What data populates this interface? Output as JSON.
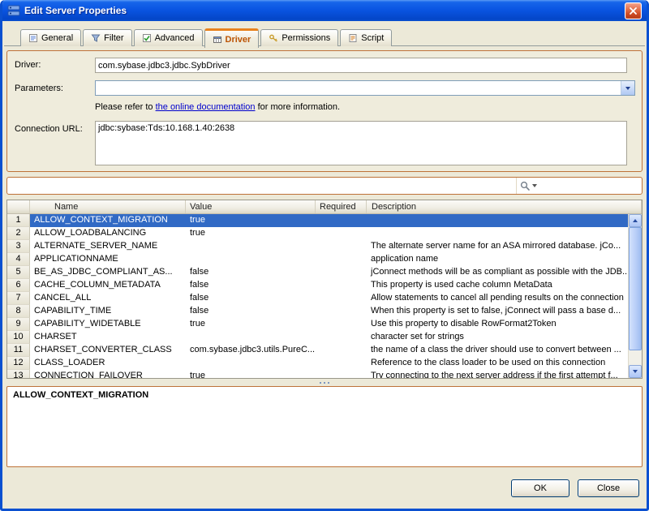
{
  "window": {
    "title": "Edit Server Properties"
  },
  "tabs": [
    {
      "label": "General"
    },
    {
      "label": "Filter"
    },
    {
      "label": "Advanced"
    },
    {
      "label": "Driver"
    },
    {
      "label": "Permissions"
    },
    {
      "label": "Script"
    }
  ],
  "form": {
    "driver_label": "Driver:",
    "driver_value": "com.sybase.jdbc3.jdbc.SybDriver",
    "parameters_label": "Parameters:",
    "parameters_value": "",
    "note_prefix": "Please refer to ",
    "note_link": "the online documentation",
    "note_suffix": " for more information.",
    "connection_url_label": "Connection URL:",
    "connection_url_value": "jdbc:sybase:Tds:10.168.1.40:2638"
  },
  "search": {
    "value": ""
  },
  "table": {
    "headers": {
      "name": "Name",
      "value": "Value",
      "required": "Required",
      "description": "Description"
    },
    "rows": [
      {
        "num": "1",
        "name": "ALLOW_CONTEXT_MIGRATION",
        "value": "true",
        "required": "",
        "description": "",
        "selected": true
      },
      {
        "num": "2",
        "name": "ALLOW_LOADBALANCING",
        "value": "true",
        "required": "",
        "description": ""
      },
      {
        "num": "3",
        "name": "ALTERNATE_SERVER_NAME",
        "value": "",
        "required": "",
        "description": "The alternate server name for an ASA mirrored database. jCo..."
      },
      {
        "num": "4",
        "name": "APPLICATIONNAME",
        "value": "",
        "required": "",
        "description": "application name"
      },
      {
        "num": "5",
        "name": "BE_AS_JDBC_COMPLIANT_AS...",
        "value": "false",
        "required": "",
        "description": "jConnect methods will be as compliant as possible with the JDB..."
      },
      {
        "num": "6",
        "name": "CACHE_COLUMN_METADATA",
        "value": "false",
        "required": "",
        "description": "This property is used cache column MetaData"
      },
      {
        "num": "7",
        "name": "CANCEL_ALL",
        "value": "false",
        "required": "",
        "description": "Allow statements to cancel all pending results on the connection"
      },
      {
        "num": "8",
        "name": "CAPABILITY_TIME",
        "value": "false",
        "required": "",
        "description": "When this property is set to false, jConnect will pass a base d..."
      },
      {
        "num": "9",
        "name": "CAPABILITY_WIDETABLE",
        "value": "true",
        "required": "",
        "description": "Use this property to disable RowFormat2Token"
      },
      {
        "num": "10",
        "name": "CHARSET",
        "value": "",
        "required": "",
        "description": "character set for strings"
      },
      {
        "num": "11",
        "name": "CHARSET_CONVERTER_CLASS",
        "value": "com.sybase.jdbc3.utils.PureC...",
        "required": "",
        "description": "the name of a class the driver should use to convert between ..."
      },
      {
        "num": "12",
        "name": "CLASS_LOADER",
        "value": "",
        "required": "",
        "description": "Reference to the class loader to be used on this connection"
      },
      {
        "num": "13",
        "name": "CONNECTION_FAILOVER",
        "value": "true",
        "required": "",
        "description": "Try connecting to the next server address if the first attempt f..."
      }
    ]
  },
  "detail": {
    "selected_property": "ALLOW_CONTEXT_MIGRATION"
  },
  "buttons": {
    "ok": "OK",
    "close": "Close"
  },
  "colors": {
    "accent_orange": "#BE7239",
    "selection_blue": "#316AC5",
    "title_blue": "#0A50D0",
    "link_blue": "#0000CC"
  }
}
